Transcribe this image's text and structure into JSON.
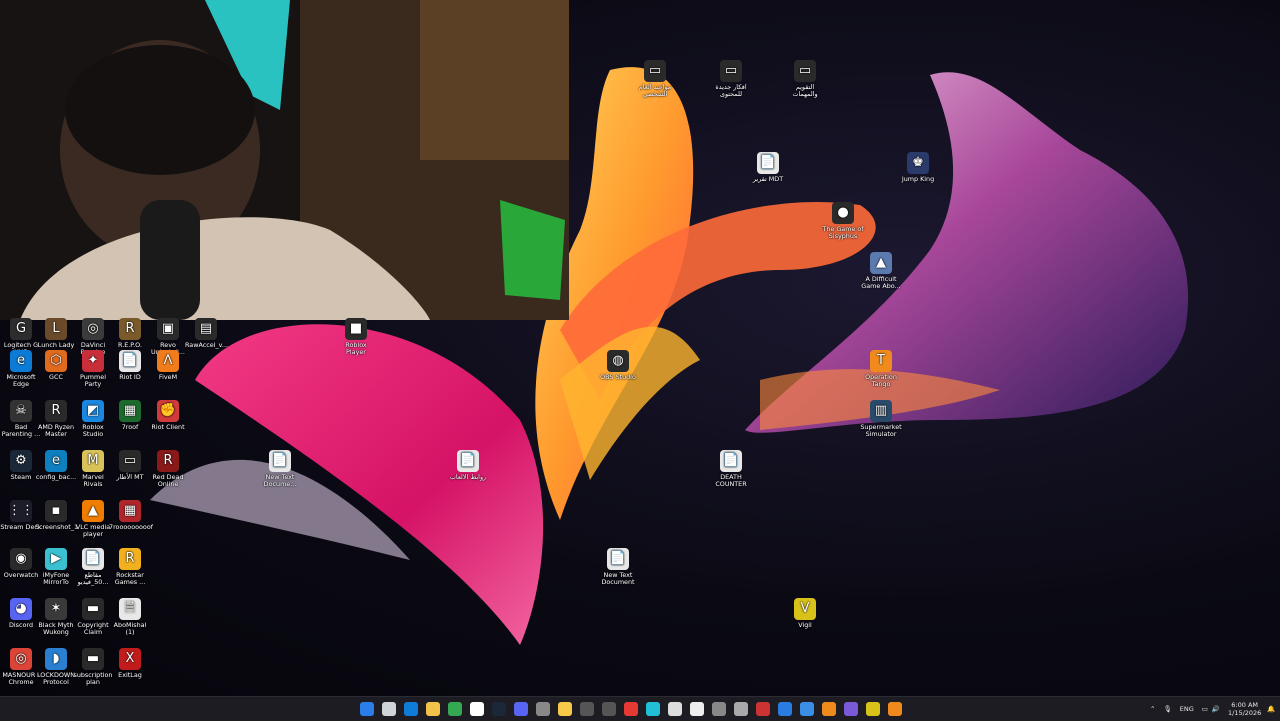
{
  "desktop_icons": [
    {
      "label": "Logitech G HUB",
      "color": "#2d2d2d",
      "glyph": "G"
    },
    {
      "label": "Lunch Lady",
      "color": "#6b4a2a",
      "glyph": "L"
    },
    {
      "label": "DaVinci Resolve",
      "color": "#3b3b3b",
      "glyph": "◎"
    },
    {
      "label": "R.E.P.O.",
      "color": "#7a5a2a",
      "glyph": "R"
    },
    {
      "label": "Revo Uninstall...",
      "color": "#2a2a2a",
      "glyph": "▣"
    },
    {
      "label": "RawAccel_v...",
      "color": "#2a2a2a",
      "glyph": "▤"
    },
    {
      "label": "Roblox Player",
      "color": "#2a2a2a",
      "glyph": "■"
    },
    {
      "label": "Microsoft Edge",
      "color": "#0c7bd6",
      "glyph": "e"
    },
    {
      "label": "GCC",
      "color": "#e06a1e",
      "glyph": "⬡"
    },
    {
      "label": "Pummel Party",
      "color": "#c92f3a",
      "glyph": "✦"
    },
    {
      "label": "Riot ID",
      "color": "#e8e8e8",
      "glyph": "📄"
    },
    {
      "label": "FiveM",
      "color": "#f07c1c",
      "glyph": "ᐱ"
    },
    {
      "label": "Bad Parenting ...",
      "color": "#333",
      "glyph": "☠"
    },
    {
      "label": "AMD Ryzen Master",
      "color": "#2a2a2a",
      "glyph": "R"
    },
    {
      "label": "Roblox Studio",
      "color": "#1a88e0",
      "glyph": "◩"
    },
    {
      "label": "7roof",
      "color": "#1c6b2d",
      "glyph": "▦"
    },
    {
      "label": "Riot Client",
      "color": "#d13b3b",
      "glyph": "✊"
    },
    {
      "label": "Steam",
      "color": "#1b2838",
      "glyph": "⚙"
    },
    {
      "label": "config_bac...",
      "color": "#0e7fbf",
      "glyph": "e"
    },
    {
      "label": "Marvel Rivals",
      "color": "#d8c25a",
      "glyph": "M"
    },
    {
      "label": "الأطار MT",
      "color": "#2a2a2a",
      "glyph": "▭"
    },
    {
      "label": "Red Dead Online",
      "color": "#8a1a1a",
      "glyph": "R"
    },
    {
      "label": "Stream Deck",
      "color": "#1d1d2a",
      "glyph": "⋮⋮"
    },
    {
      "label": "Screenshot_1",
      "color": "#2a2a2a",
      "glyph": "▪"
    },
    {
      "label": "VLC media player",
      "color": "#f07c00",
      "glyph": "▲"
    },
    {
      "label": "7rooooooooof",
      "color": "#b0262a",
      "glyph": "▦"
    },
    {
      "label": "Overwatch",
      "color": "#2a2a2a",
      "glyph": "◉"
    },
    {
      "label": "iMyFone MirrorTo",
      "color": "#3ac0d0",
      "glyph": "▶"
    },
    {
      "label": "مقاطع 50_فيديو...",
      "color": "#e8e8e8",
      "glyph": "📄"
    },
    {
      "label": "Rockstar Games ...",
      "color": "#f2b01e",
      "glyph": "R"
    },
    {
      "label": "Discord",
      "color": "#5865f2",
      "glyph": "◕"
    },
    {
      "label": "Black Myth Wukong",
      "color": "#3a3a3a",
      "glyph": "✶"
    },
    {
      "label": "Copyright Claim",
      "color": "#2a2a2a",
      "glyph": "▬"
    },
    {
      "label": "AboMishal (1)",
      "color": "#e8e8e8",
      "glyph": "🗎"
    },
    {
      "label": "MASNOUR - Chrome",
      "color": "#db4437",
      "glyph": "◎"
    },
    {
      "label": "LOCKDOWN Protocol",
      "color": "#2a7fd0",
      "glyph": "◗"
    },
    {
      "label": "subscription plan",
      "color": "#2a2a2a",
      "glyph": "▬"
    },
    {
      "label": "ExitLag",
      "color": "#c21b1b",
      "glyph": "X"
    },
    {
      "label": "مواعيد العام الشخصي",
      "color": "#2a2a2a",
      "glyph": "▭"
    },
    {
      "label": "افكار جديدة للمحتوى",
      "color": "#2a2a2a",
      "glyph": "▭"
    },
    {
      "label": "التقويم والمهمات",
      "color": "#2a2a2a",
      "glyph": "▭"
    },
    {
      "label": "تقرير MDT",
      "color": "#e8e8e8",
      "glyph": "📄"
    },
    {
      "label": "Jump King",
      "color": "#2a3a6a",
      "glyph": "♚"
    },
    {
      "label": "The Game of Sisyphus",
      "color": "#2a2a2a",
      "glyph": "●"
    },
    {
      "label": "A Difficult Game Abo...",
      "color": "#5a7ab0",
      "glyph": "▲"
    },
    {
      "label": "OBS Studio",
      "color": "#2a2a2a",
      "glyph": "◍"
    },
    {
      "label": "Operation Tango",
      "color": "#f08a1c",
      "glyph": "T"
    },
    {
      "label": "Supermarket Simulator",
      "color": "#2a4a6a",
      "glyph": "▥"
    },
    {
      "label": "New Text Docume...",
      "color": "#e8e8e8",
      "glyph": "📄"
    },
    {
      "label": "روابط الالعاب",
      "color": "#e8e8e8",
      "glyph": "📄"
    },
    {
      "label": "DEATH COUNTER",
      "color": "#e8e8e8",
      "glyph": "📄"
    },
    {
      "label": "New Text Document",
      "color": "#e8e8e8",
      "glyph": "📄"
    },
    {
      "label": "Vigil",
      "color": "#d8c21a",
      "glyph": "V"
    }
  ],
  "taskbar": {
    "apps": [
      "start-icon",
      "search-icon",
      "edge-icon",
      "file-explorer-icon",
      "chrome-icon",
      "capcut-icon",
      "steam-icon",
      "discord-icon",
      "app-icon",
      "notes-icon",
      "obs-icon",
      "terminal-icon",
      "youtube-icon",
      "photos-icon",
      "chatgpt-icon",
      "battlefield-icon",
      "app-icon-2",
      "esc-icon",
      "app-icon-3",
      "settings-icon",
      "notepad-icon",
      "tango-icon",
      "app-icon-4",
      "vigil-icon",
      "app-icon-5"
    ],
    "language": "ENG",
    "time": "6:00 AM",
    "date": "1/15/2026"
  }
}
